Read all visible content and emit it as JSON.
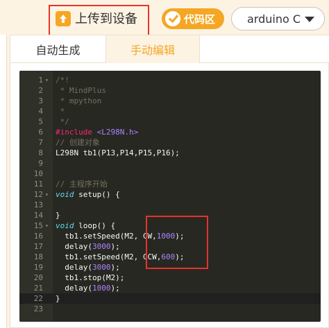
{
  "toolbar": {
    "upload_label": "上传到设备",
    "code_toggle_label": "代码区",
    "board_select_value": "arduino C"
  },
  "tabs": [
    {
      "label": "自动生成",
      "active": false
    },
    {
      "label": "手动编辑",
      "active": true
    }
  ],
  "colors": {
    "accent": "#f5a623",
    "highlight_box": "#e8332a",
    "editor_bg": "#272822"
  },
  "icons": {
    "upload": "upload-arrow-icon",
    "toggle": "check-icon",
    "caret": "chevron-down-icon"
  },
  "editor": {
    "active_line": 22,
    "lines": [
      {
        "n": "1",
        "fold": "▾",
        "tokens": [
          {
            "t": "/*!",
            "c": "c-comment"
          }
        ]
      },
      {
        "n": "2",
        "fold": "",
        "tokens": [
          {
            "t": " * MindPlus",
            "c": "c-comment"
          }
        ]
      },
      {
        "n": "3",
        "fold": "",
        "tokens": [
          {
            "t": " * mpython",
            "c": "c-comment"
          }
        ]
      },
      {
        "n": "4",
        "fold": "",
        "tokens": [
          {
            "t": " *",
            "c": "c-comment"
          }
        ]
      },
      {
        "n": "5",
        "fold": "",
        "tokens": [
          {
            "t": " */",
            "c": "c-comment"
          }
        ]
      },
      {
        "n": "6",
        "fold": "",
        "tokens": [
          {
            "t": "#include ",
            "c": "c-pre"
          },
          {
            "t": "<L298N.h>",
            "c": "c-num"
          }
        ]
      },
      {
        "n": "7",
        "fold": "",
        "tokens": [
          {
            "t": "// 创建对象",
            "c": "c-comment"
          }
        ]
      },
      {
        "n": "8",
        "fold": "",
        "tokens": [
          {
            "t": "L298N tb1(P13,P14,P15,P16);",
            "c": "c-plain"
          }
        ]
      },
      {
        "n": "9",
        "fold": "",
        "tokens": []
      },
      {
        "n": "10",
        "fold": "",
        "tokens": []
      },
      {
        "n": "11",
        "fold": "",
        "tokens": [
          {
            "t": "// 主程序开始",
            "c": "c-comment"
          }
        ]
      },
      {
        "n": "12",
        "fold": "▾",
        "tokens": [
          {
            "t": "void",
            "c": "c-type"
          },
          {
            "t": " setup() {",
            "c": "c-plain"
          }
        ]
      },
      {
        "n": "13",
        "fold": "",
        "tokens": []
      },
      {
        "n": "14",
        "fold": "",
        "tokens": [
          {
            "t": "}",
            "c": "c-plain"
          }
        ]
      },
      {
        "n": "15",
        "fold": "▾",
        "tokens": [
          {
            "t": "void",
            "c": "c-type"
          },
          {
            "t": " loop() {",
            "c": "c-plain"
          }
        ]
      },
      {
        "n": "16",
        "fold": "",
        "tokens": [
          {
            "t": "  tb1.setSpeed(M2, CW,",
            "c": "c-plain"
          },
          {
            "t": "1000",
            "c": "c-num"
          },
          {
            "t": ");",
            "c": "c-plain"
          }
        ]
      },
      {
        "n": "17",
        "fold": "",
        "tokens": [
          {
            "t": "  delay(",
            "c": "c-plain"
          },
          {
            "t": "3000",
            "c": "c-num"
          },
          {
            "t": ");",
            "c": "c-plain"
          }
        ]
      },
      {
        "n": "18",
        "fold": "",
        "tokens": [
          {
            "t": "  tb1.setSpeed(M2, CCW,",
            "c": "c-plain"
          },
          {
            "t": "600",
            "c": "c-num"
          },
          {
            "t": ");",
            "c": "c-plain"
          }
        ]
      },
      {
        "n": "19",
        "fold": "",
        "tokens": [
          {
            "t": "  delay(",
            "c": "c-plain"
          },
          {
            "t": "3000",
            "c": "c-num"
          },
          {
            "t": ");",
            "c": "c-plain"
          }
        ]
      },
      {
        "n": "20",
        "fold": "",
        "tokens": [
          {
            "t": "  tb1.stop(M2);",
            "c": "c-plain"
          }
        ]
      },
      {
        "n": "21",
        "fold": "",
        "tokens": [
          {
            "t": "  delay(",
            "c": "c-plain"
          },
          {
            "t": "1000",
            "c": "c-num"
          },
          {
            "t": ");",
            "c": "c-plain"
          }
        ]
      },
      {
        "n": "22",
        "fold": "",
        "tokens": [
          {
            "t": "}",
            "c": "c-plain"
          }
        ]
      },
      {
        "n": "23",
        "fold": "",
        "tokens": []
      }
    ]
  }
}
